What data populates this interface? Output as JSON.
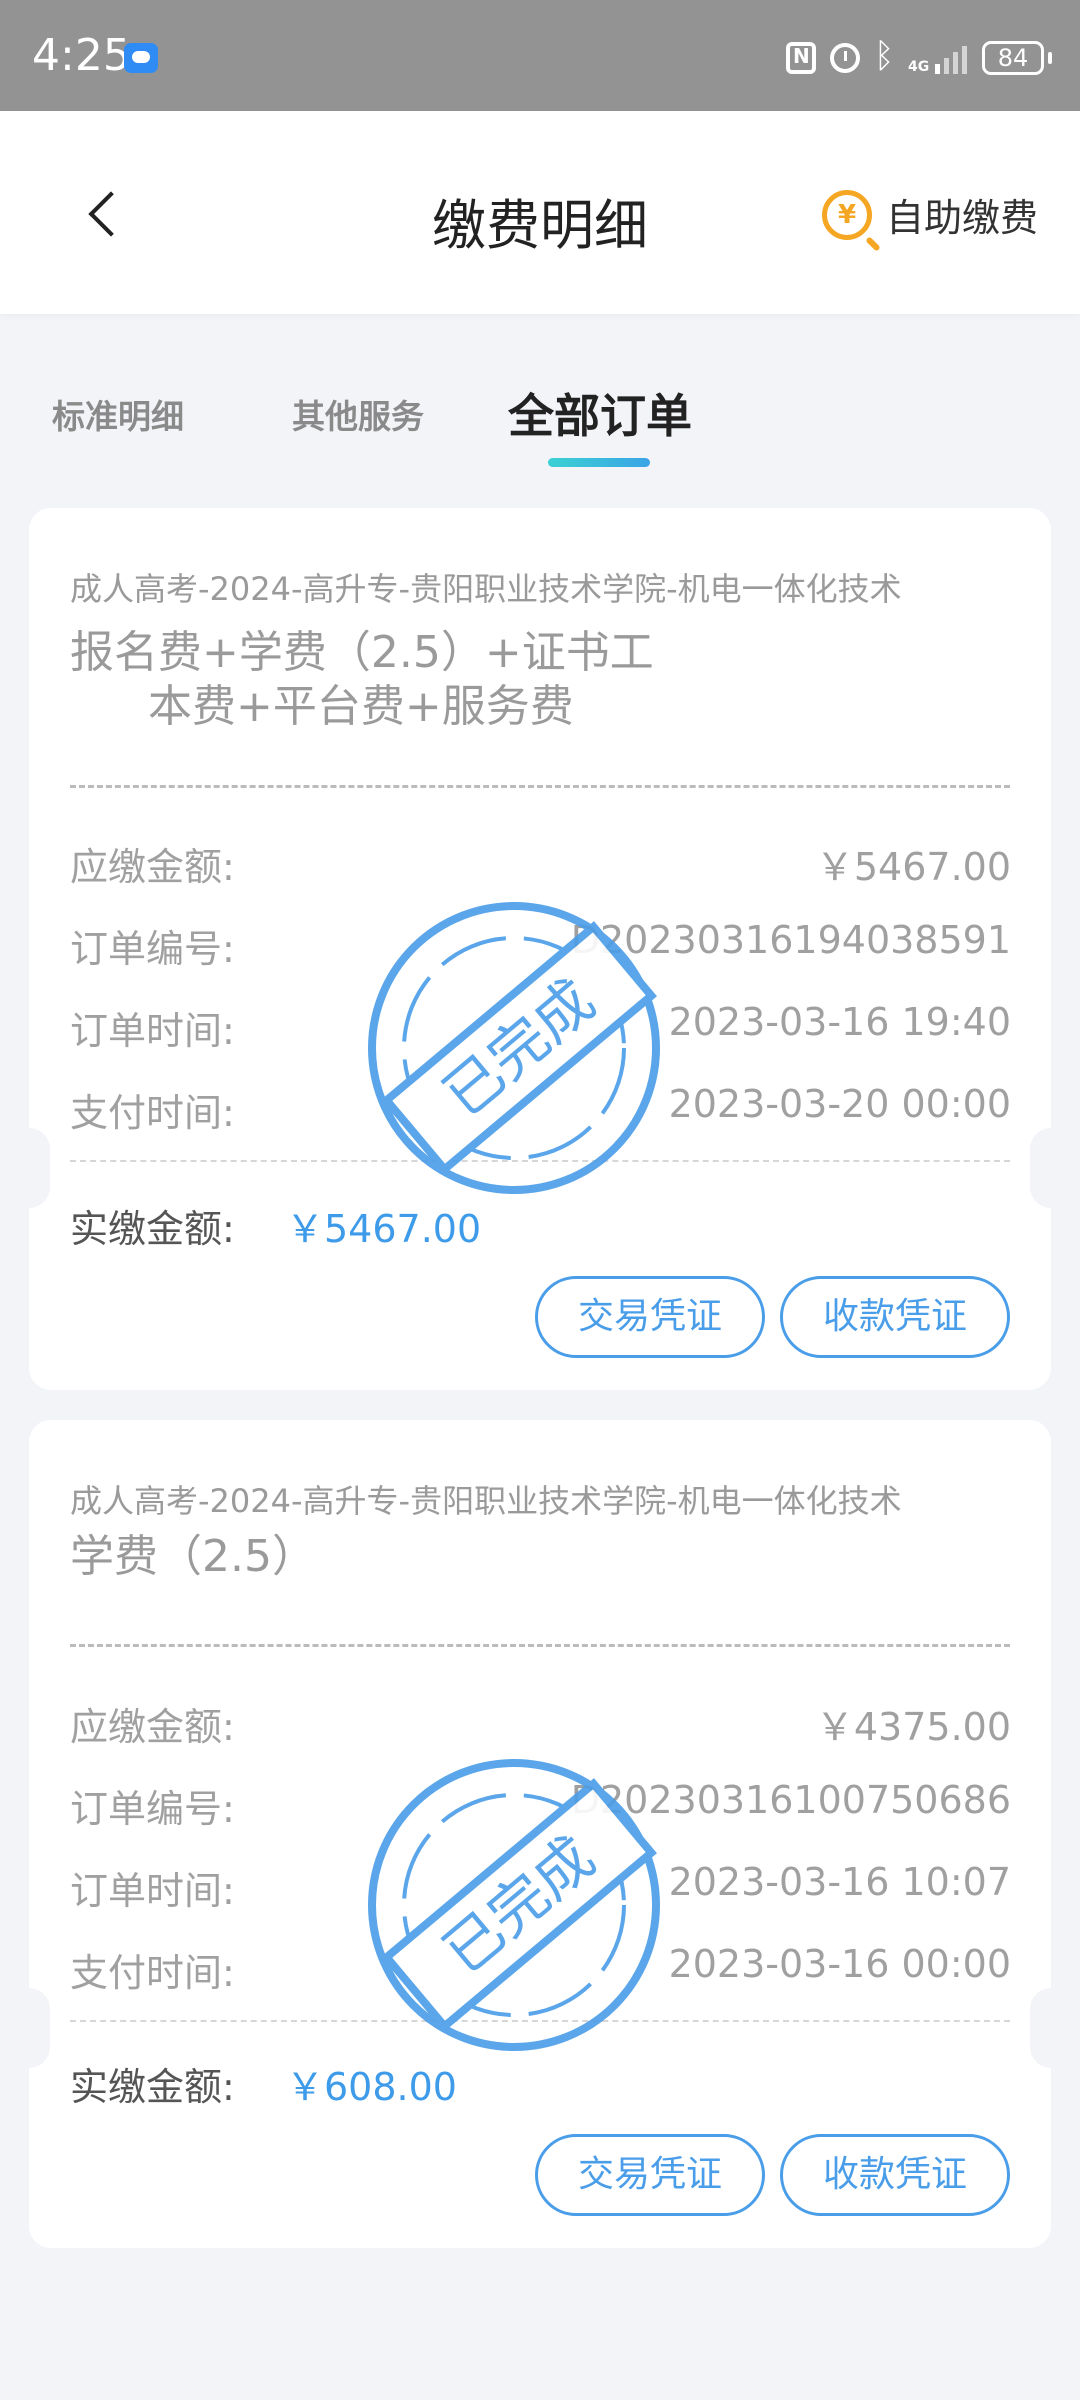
{
  "status_bar": {
    "time": "4:25",
    "network": "4G",
    "battery": "84"
  },
  "header": {
    "title": "缴费明细",
    "self_pay_icon": "¥",
    "self_pay_label": "自助缴费"
  },
  "tabs": [
    {
      "label": "标准明细"
    },
    {
      "label": "其他服务"
    },
    {
      "label": "全部订单",
      "active": true
    }
  ],
  "orders": [
    {
      "title": "成人高考-2024-高升专-贵阳职业技术学院-机电一体化技术",
      "desc_line1": "报名费+学费（2.5）+证书工",
      "desc_line2": "本费+平台费+服务费",
      "due_label": "应缴金额:",
      "due_value": "￥5467.00",
      "order_no_label": "订单编号:",
      "order_no_value": "D20230316194038591",
      "order_time_label": "订单时间:",
      "order_time_value": "2023-03-16 19:40",
      "pay_time_label": "支付时间:",
      "pay_time_value": "2023-03-20 00:00",
      "paid_label": "实缴金额:",
      "paid_value": "￥5467.00",
      "stamp_text": "已完成",
      "btn_trade": "交易凭证",
      "btn_receipt": "收款凭证"
    },
    {
      "title": "成人高考-2024-高升专-贵阳职业技术学院-机电一体化技术",
      "desc_line1": "学费（2.5）",
      "due_label": "应缴金额:",
      "due_value": "￥4375.00",
      "order_no_label": "订单编号:",
      "order_no_value": "D20230316100750686",
      "order_time_label": "订单时间:",
      "order_time_value": "2023-03-16 10:07",
      "pay_time_label": "支付时间:",
      "pay_time_value": "2023-03-16 00:00",
      "paid_label": "实缴金额:",
      "paid_value": "￥608.00",
      "stamp_text": "已完成",
      "btn_trade": "交易凭证",
      "btn_receipt": "收款凭证"
    }
  ],
  "colors": {
    "accent": "#4a9de8",
    "amount": "#3d9bea",
    "self_pay": "#f5a623",
    "status_bar": "#939393"
  }
}
